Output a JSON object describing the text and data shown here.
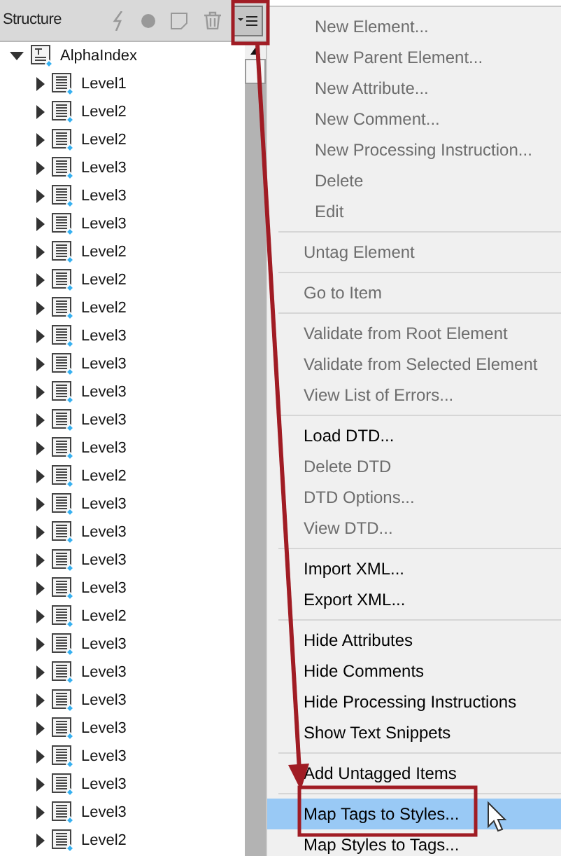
{
  "panel": {
    "title": "Structure",
    "menu_button": {
      "selected": true
    }
  },
  "tree": {
    "label": "AlphaIndex",
    "expanded": true,
    "children": [
      {
        "label": "Level1"
      },
      {
        "label": "Level2"
      },
      {
        "label": "Level2"
      },
      {
        "label": "Level3"
      },
      {
        "label": "Level3"
      },
      {
        "label": "Level3"
      },
      {
        "label": "Level2"
      },
      {
        "label": "Level2"
      },
      {
        "label": "Level2"
      },
      {
        "label": "Level3"
      },
      {
        "label": "Level3"
      },
      {
        "label": "Level3"
      },
      {
        "label": "Level3"
      },
      {
        "label": "Level3"
      },
      {
        "label": "Level2"
      },
      {
        "label": "Level3"
      },
      {
        "label": "Level3"
      },
      {
        "label": "Level3"
      },
      {
        "label": "Level3"
      },
      {
        "label": "Level2"
      },
      {
        "label": "Level3"
      },
      {
        "label": "Level3"
      },
      {
        "label": "Level3"
      },
      {
        "label": "Level3"
      },
      {
        "label": "Level3"
      },
      {
        "label": "Level3"
      },
      {
        "label": "Level3"
      },
      {
        "label": "Level2"
      }
    ]
  },
  "menu": {
    "groups": [
      [
        {
          "label": "New Element...",
          "disabled": true,
          "selected": false
        },
        {
          "label": "New Parent Element...",
          "disabled": true,
          "selected": false
        },
        {
          "label": "New Attribute...",
          "disabled": true,
          "selected": false
        },
        {
          "label": "New Comment...",
          "disabled": true,
          "selected": false
        },
        {
          "label": "New Processing Instruction...",
          "disabled": true,
          "selected": false
        },
        {
          "label": "Delete",
          "disabled": true,
          "selected": false
        },
        {
          "label": "Edit",
          "disabled": true,
          "selected": false
        }
      ],
      [
        {
          "label": "Untag Element",
          "disabled": true,
          "selected": false
        }
      ],
      [
        {
          "label": "Go to Item",
          "disabled": true,
          "selected": false
        }
      ],
      [
        {
          "label": "Validate from Root Element",
          "disabled": true,
          "selected": false
        },
        {
          "label": "Validate from Selected Element",
          "disabled": true,
          "selected": false
        },
        {
          "label": "View List of Errors...",
          "disabled": true,
          "selected": false
        }
      ],
      [
        {
          "label": "Load DTD...",
          "disabled": false,
          "selected": false
        },
        {
          "label": "Delete DTD",
          "disabled": true,
          "selected": false
        },
        {
          "label": "DTD Options...",
          "disabled": true,
          "selected": false
        },
        {
          "label": "View DTD...",
          "disabled": true,
          "selected": false
        }
      ],
      [
        {
          "label": "Import XML...",
          "disabled": false,
          "selected": false
        },
        {
          "label": "Export XML...",
          "disabled": false,
          "selected": false
        }
      ],
      [
        {
          "label": "Hide Attributes",
          "disabled": false,
          "selected": false
        },
        {
          "label": "Hide Comments",
          "disabled": false,
          "selected": false
        },
        {
          "label": "Hide Processing Instructions",
          "disabled": false,
          "selected": false
        },
        {
          "label": "Show Text Snippets",
          "disabled": false,
          "selected": false
        }
      ],
      [
        {
          "label": "Add Untagged Items",
          "disabled": false,
          "selected": false
        }
      ],
      [
        {
          "label": "Map Tags to Styles...",
          "disabled": false,
          "selected": true
        },
        {
          "label": "Map Styles to Tags...",
          "disabled": false,
          "selected": false
        }
      ]
    ]
  }
}
